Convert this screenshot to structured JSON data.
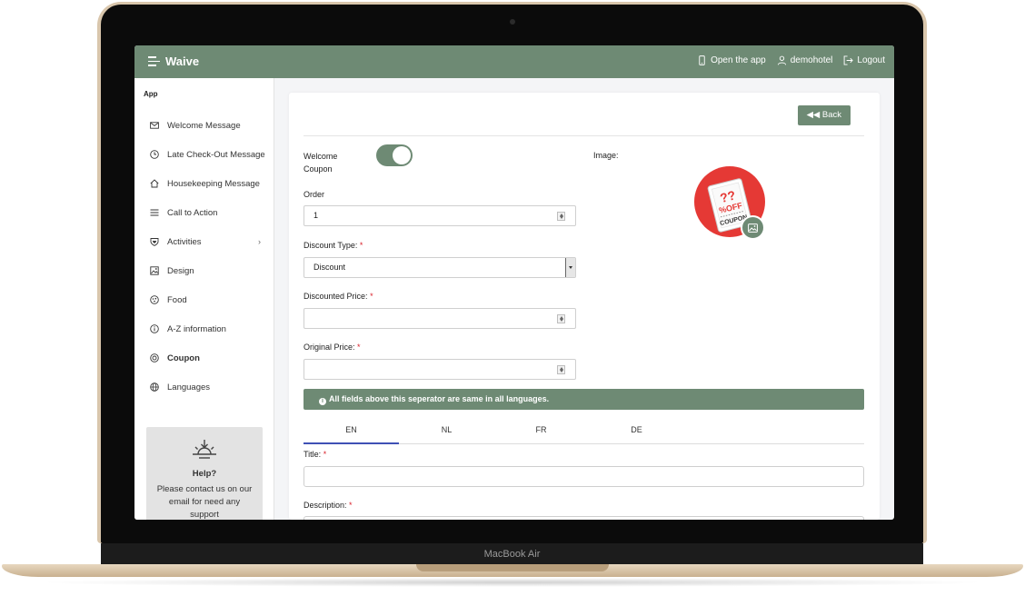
{
  "device": {
    "label": "MacBook Air"
  },
  "topbar": {
    "brand": "Waive",
    "open_app": "Open the app",
    "user": "demohotel",
    "logout": "Logout"
  },
  "sidebar": {
    "heading": "App",
    "items": [
      {
        "label": "Welcome Message",
        "icon": "envelope-icon"
      },
      {
        "label": "Late Check-Out Message",
        "icon": "clock-icon"
      },
      {
        "label": "Housekeeping Message",
        "icon": "home-icon"
      },
      {
        "label": "Call to Action",
        "icon": "menu-lines-icon"
      },
      {
        "label": "Activities",
        "icon": "heart-shield-icon"
      },
      {
        "label": "Design",
        "icon": "image-icon"
      },
      {
        "label": "Food",
        "icon": "food-icon"
      },
      {
        "label": "A-Z information",
        "icon": "info-icon"
      },
      {
        "label": "Coupon",
        "icon": "coupon-icon"
      },
      {
        "label": "Languages",
        "icon": "globe-icon"
      }
    ],
    "active": "Coupon",
    "help": {
      "title": "Help?",
      "text": "Please contact us on our email for need any support"
    }
  },
  "form": {
    "back_label": "Back",
    "welcome_coupon_label": "Welcome Coupon",
    "welcome_coupon_on": true,
    "order_label": "Order",
    "order_value": "1",
    "discount_type_label": "Discount Type:",
    "discount_type_value": "Discount",
    "discounted_price_label": "Discounted Price:",
    "original_price_label": "Original Price:",
    "image_label": "Image:",
    "coupon_art": {
      "question": "??",
      "off": "%OFF",
      "word": "COUPON"
    },
    "notice": "All fields above this seperator are same in all languages.",
    "tabs": [
      "EN",
      "NL",
      "FR",
      "DE"
    ],
    "active_tab": "EN",
    "title_label": "Title:",
    "description_label": "Description:",
    "required_mark": "*"
  },
  "colors": {
    "accent": "#6e8a74",
    "tab_underline": "#3f51b5",
    "required": "#d9232d",
    "coupon_red": "#e53935"
  }
}
